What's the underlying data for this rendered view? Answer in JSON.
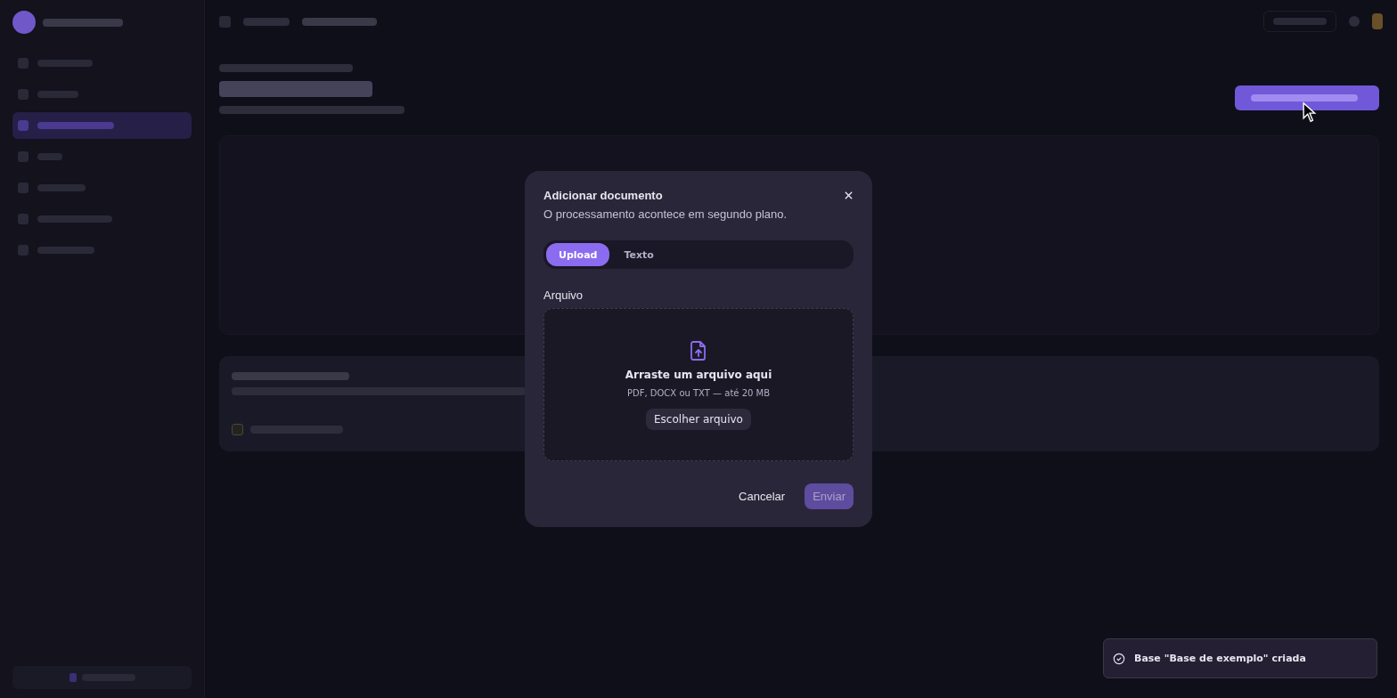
{
  "sidebar": {
    "items": [
      {
        "selected": false
      },
      {
        "selected": false
      },
      {
        "selected": true
      },
      {
        "selected": false
      },
      {
        "selected": false
      },
      {
        "selected": false
      },
      {
        "selected": false
      }
    ]
  },
  "linked_agents": [
    {
      "checked": false
    }
  ],
  "dialog": {
    "title": "Adicionar documento",
    "description": "O processamento acontece em segundo plano.",
    "tabs": [
      {
        "label": "Upload",
        "selected": true
      },
      {
        "label": "Texto",
        "selected": false
      }
    ],
    "field_label": "Arquivo",
    "drop_title": "Arraste um arquivo aqui",
    "drop_hint": "PDF, DOCX ou TXT — até 20 MB",
    "choose_button": "Escolher arquivo",
    "cancel": "Cancelar",
    "submit": "Enviar",
    "submit_disabled": true
  },
  "toast": {
    "message": "Base \"Base de exemplo\" criada"
  }
}
